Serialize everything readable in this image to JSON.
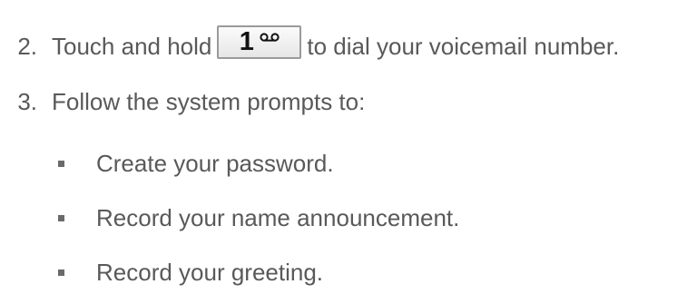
{
  "steps": [
    {
      "number": "2.",
      "text_before": "Touch and hold",
      "key_digit": "1",
      "key_icon": "voicemail-icon",
      "text_after": "to dial your voicemail number."
    },
    {
      "number": "3.",
      "text": "Follow the system prompts to:"
    }
  ],
  "sub_items": [
    "Create your password.",
    "Record your name announcement.",
    "Record your greeting."
  ]
}
